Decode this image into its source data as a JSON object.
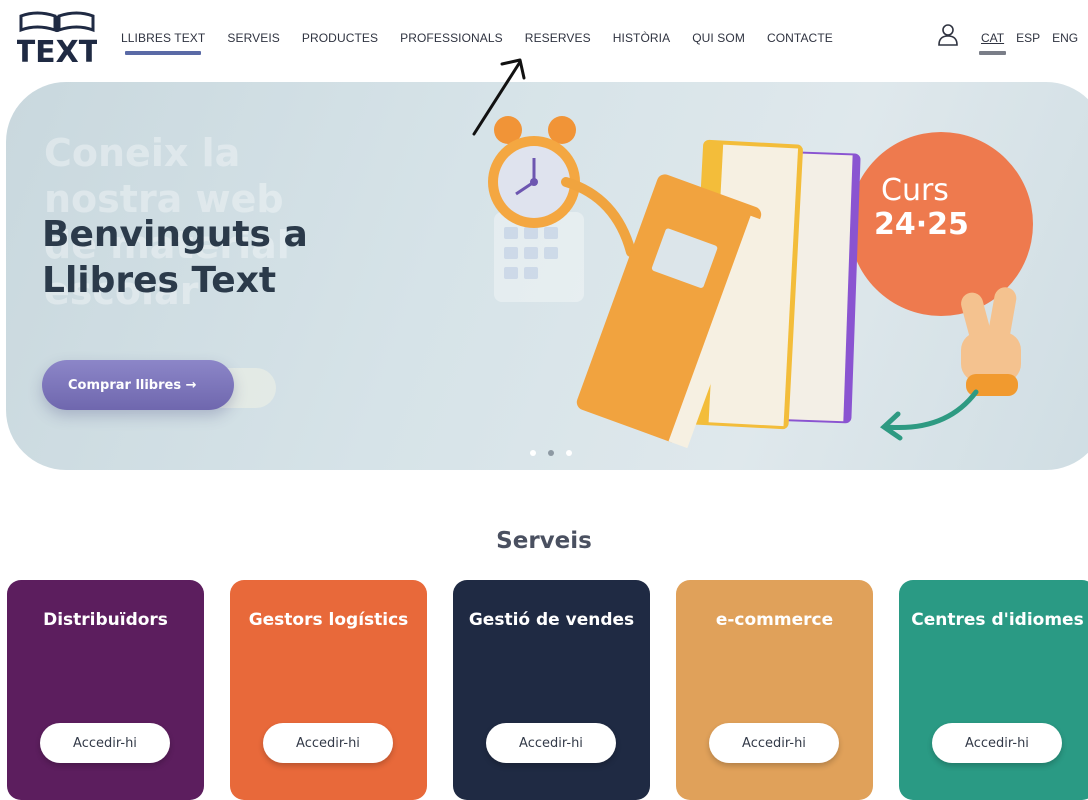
{
  "nav": {
    "menu": [
      {
        "label": "LLIBRES TEXT",
        "active": true
      },
      {
        "label": "SERVEIS"
      },
      {
        "label": "PRODUCTES"
      },
      {
        "label": "PROFESSIONALS"
      },
      {
        "label": "RESERVES"
      },
      {
        "label": "HISTÒRIA"
      },
      {
        "label": "QUI SOM"
      },
      {
        "label": "CONTACTE"
      }
    ],
    "languages": [
      {
        "label": "CAT",
        "active": true
      },
      {
        "label": "ESP"
      },
      {
        "label": "ENG"
      }
    ],
    "logo_text": "TEXT"
  },
  "hero": {
    "ghost_title": "Coneix la nostra web de material escolar",
    "title": "Benvinguts a Llibres Text",
    "cta_label": "Comprar llibres →",
    "badge_line1": "Curs",
    "badge_line2": "24·25",
    "carousel_active": 1
  },
  "services": {
    "title": "Serveis",
    "cards": [
      {
        "title": "Distribuïdors",
        "button": "Accedir-hi",
        "color": "#5c1e5e"
      },
      {
        "title": "Gestors logístics",
        "button": "Accedir-hi",
        "color": "#e8693a"
      },
      {
        "title": "Gestió de vendes",
        "button": "Accedir-hi",
        "color": "#1f2a43"
      },
      {
        "title": "e-commerce",
        "button": "Accedir-hi",
        "color": "#e0a15a"
      },
      {
        "title": "Centres d'idiomes",
        "button": "Accedir-hi",
        "color": "#2a9a84"
      }
    ]
  }
}
